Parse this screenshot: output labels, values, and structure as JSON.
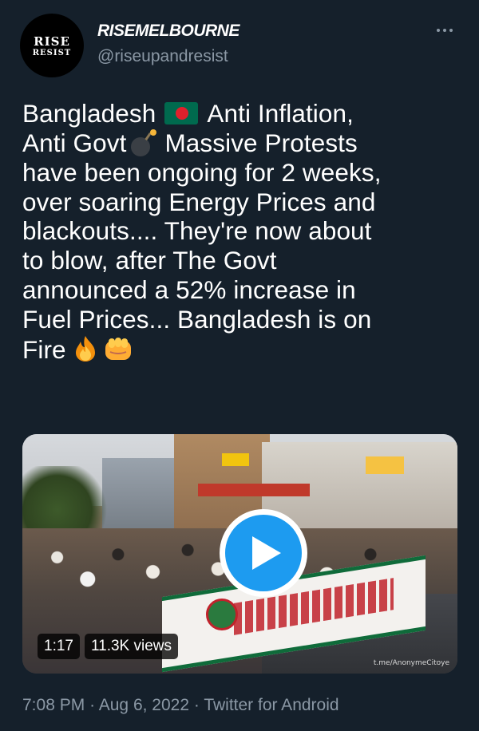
{
  "author": {
    "avatar_line1": "RISE",
    "avatar_line2": "RESIST",
    "display_name": "RISEMELBOURNE",
    "handle": "@riseupandresist"
  },
  "header": {
    "more_icon": "more-horizontal-icon"
  },
  "tweet": {
    "line1_a": "Bangladesh",
    "line1_emoji": "flag-bangladesh-icon",
    "line1_b": "Anti Inflation,",
    "line2_a": "Anti Govt",
    "line2_emoji": "bomb-icon",
    "line2_b": "Massive Protests",
    "line3": "have been ongoing for 2 weeks,",
    "line4": "over soaring Energy Prices and",
    "line5": "blackouts.... They're now about",
    "line6": "to blow, after The Govt",
    "line7": "announced a 52% increase in",
    "line8": "Fuel Prices... Bangladesh is on",
    "line9": "Fire",
    "line9_emojis": [
      "fire-icon",
      "oncoming-fist-icon"
    ]
  },
  "media": {
    "duration": "1:17",
    "views": "11.3K views",
    "watermark": "t.me/AnonymeCitoye",
    "play_icon": "play-icon",
    "colors": {
      "play_button": "#1d9bf0"
    }
  },
  "meta": {
    "time": "7:08 PM",
    "separator": "·",
    "date": "Aug 6, 2022",
    "source": "Twitter for Android"
  },
  "colors": {
    "background": "#15202b",
    "text": "#ffffff",
    "secondary_text": "#8b98a5"
  }
}
